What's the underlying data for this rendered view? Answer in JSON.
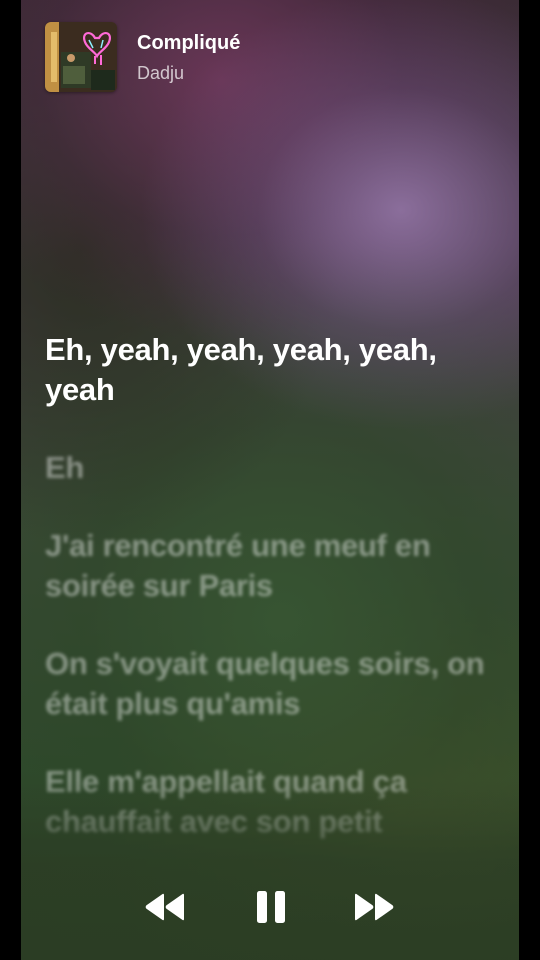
{
  "now_playing": {
    "title": "Compliqué",
    "artist": "Dadju",
    "artwork_icon": "album-artwork"
  },
  "lyrics": [
    {
      "text": "Eh, yeah, yeah, yeah, yeah, yeah",
      "state": "active"
    },
    {
      "text": "Eh",
      "state": "upcoming"
    },
    {
      "text": "J'ai rencontré une meuf en soirée sur Paris",
      "state": "upcoming"
    },
    {
      "text": "On s'voyait quelques soirs, on était plus qu'amis",
      "state": "upcoming"
    },
    {
      "text": "Elle m'appellait quand ça chauffait avec son petit",
      "state": "upcoming"
    }
  ],
  "controls": {
    "rewind_icon": "rewind-icon",
    "pause_icon": "pause-icon",
    "forward_icon": "fast-forward-icon"
  },
  "colors": {
    "active_lyric": "#ffffff",
    "inactive_lyric": "rgba(255,255,255,0.42)",
    "controls": "#ffffff"
  }
}
